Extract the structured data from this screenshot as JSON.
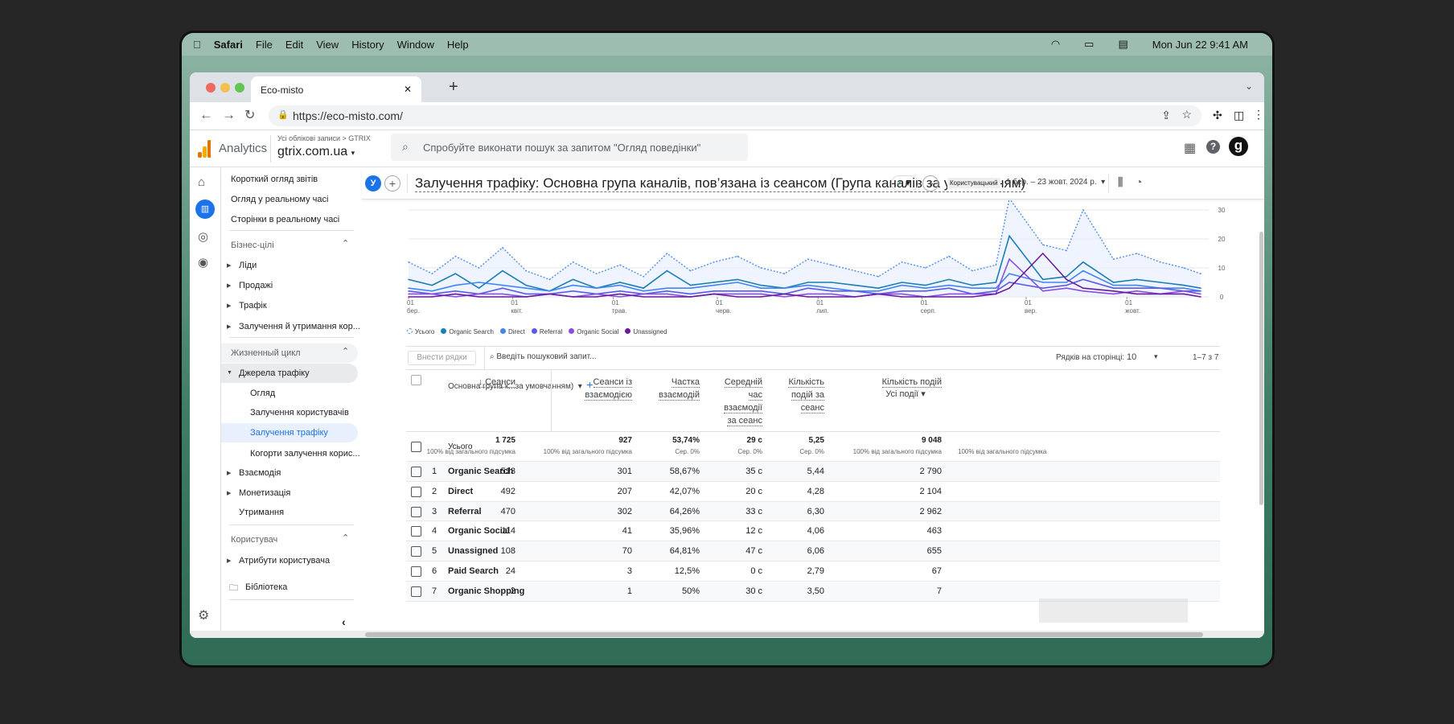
{
  "menubar": {
    "app": "Safari",
    "items": [
      "File",
      "Edit",
      "View",
      "History",
      "Window",
      "Help"
    ],
    "clock": "Mon Jun 22  9:41 AM"
  },
  "browser": {
    "tab_title": "Eco-misto",
    "url": "https://eco-misto.com/"
  },
  "ga": {
    "product": "Analytics",
    "breadcrumb": "Усі облікові записи > GTRIX",
    "property": "gtrix.com.ua",
    "search_placeholder": "Спробуйте виконати пошук за запитом \"Огляд поведінки\"",
    "avatar": "g"
  },
  "nav": {
    "top": [
      "Короткий огляд звітів",
      "Огляд у реальному часі",
      "Сторінки в реальному часі"
    ],
    "business": "Бізнес-цілі",
    "business_items": [
      "Ліди",
      "Продажі",
      "Трафік",
      "Залучення й утримання кор..."
    ],
    "lifecycle": "Жизненный цикл",
    "traffic_sources": "Джерела трафіку",
    "traffic_sub": [
      "Огляд",
      "Залучення користувачів",
      "Залучення трафіку",
      "Когорти залучення корис..."
    ],
    "lifecycle_items": [
      "Взаємодія",
      "Монетизація",
      "Утримання"
    ],
    "user": "Користувач",
    "user_items": [
      "Атрибути користувача"
    ],
    "library": "Бібліотека"
  },
  "report": {
    "segment_badge": "У",
    "title": "Залучення трафіку: Основна група каналів, пов’язана із сеансом (Група каналів за умовчанням)",
    "date_type": "Користувацький",
    "date_range": "1 бер. – 23 жовт. 2024 р."
  },
  "chart_data": {
    "type": "line",
    "ylim": [
      0,
      30
    ],
    "yticks": [
      0,
      10,
      20,
      30
    ],
    "grid": true,
    "legend_position": "bottom-left",
    "xticks": [
      {
        "date": "2024-03-01",
        "l1": "01",
        "l2": "бер."
      },
      {
        "date": "2024-04-01",
        "l1": "01",
        "l2": "квіт."
      },
      {
        "date": "2024-05-01",
        "l1": "01",
        "l2": "трав."
      },
      {
        "date": "2024-06-01",
        "l1": "01",
        "l2": "черв."
      },
      {
        "date": "2024-07-01",
        "l1": "01",
        "l2": "лип."
      },
      {
        "date": "2024-08-01",
        "l1": "01",
        "l2": "серп."
      },
      {
        "date": "2024-09-01",
        "l1": "01",
        "l2": "вер."
      },
      {
        "date": "2024-10-01",
        "l1": "01",
        "l2": "жовт."
      }
    ],
    "x": [
      "2024-03-01",
      "2024-03-08",
      "2024-03-15",
      "2024-03-22",
      "2024-03-29",
      "2024-04-05",
      "2024-04-12",
      "2024-04-19",
      "2024-04-26",
      "2024-05-03",
      "2024-05-10",
      "2024-05-17",
      "2024-05-24",
      "2024-05-31",
      "2024-06-07",
      "2024-06-14",
      "2024-06-21",
      "2024-06-28",
      "2024-07-05",
      "2024-07-12",
      "2024-07-19",
      "2024-07-26",
      "2024-08-02",
      "2024-08-09",
      "2024-08-16",
      "2024-08-23",
      "2024-08-27",
      "2024-09-06",
      "2024-09-13",
      "2024-09-18",
      "2024-09-27",
      "2024-10-04",
      "2024-10-11",
      "2024-10-18",
      "2024-10-23"
    ],
    "series": [
      {
        "name": "Усього",
        "color": "#4d8ef0",
        "style": "dotted",
        "values": [
          12,
          8,
          14,
          10,
          17,
          9,
          6,
          12,
          8,
          11,
          7,
          15,
          9,
          12,
          14,
          10,
          8,
          13,
          11,
          9,
          7,
          12,
          10,
          14,
          9,
          11,
          34,
          18,
          16,
          30,
          13,
          15,
          12,
          10,
          8
        ]
      },
      {
        "name": "Organic Search",
        "color": "#1a7fb5",
        "values": [
          6,
          4,
          8,
          3,
          9,
          4,
          2,
          6,
          3,
          5,
          3,
          9,
          4,
          5,
          6,
          4,
          3,
          5,
          5,
          4,
          3,
          5,
          4,
          6,
          4,
          5,
          21,
          6,
          7,
          12,
          5,
          6,
          5,
          4,
          3
        ]
      },
      {
        "name": "Direct",
        "color": "#4285f4",
        "values": [
          3,
          2,
          4,
          5,
          4,
          3,
          2,
          4,
          3,
          4,
          2,
          3,
          3,
          4,
          5,
          3,
          3,
          4,
          3,
          2,
          2,
          4,
          3,
          4,
          3,
          3,
          8,
          5,
          5,
          9,
          4,
          4,
          3,
          3,
          2
        ]
      },
      {
        "name": "Referral",
        "color": "#5b5bea",
        "values": [
          2,
          1,
          2,
          1,
          3,
          1,
          1,
          2,
          1,
          2,
          1,
          2,
          1,
          2,
          2,
          2,
          1,
          3,
          2,
          2,
          1,
          2,
          2,
          3,
          1,
          2,
          5,
          3,
          4,
          6,
          3,
          3,
          3,
          2,
          2
        ]
      },
      {
        "name": "Organic Social",
        "color": "#8a4fe0",
        "values": [
          1,
          1,
          0,
          1,
          1,
          0,
          1,
          0,
          1,
          0,
          1,
          1,
          0,
          1,
          1,
          1,
          0,
          1,
          1,
          0,
          1,
          1,
          0,
          1,
          1,
          1,
          13,
          2,
          3,
          2,
          1,
          2,
          1,
          2,
          1
        ]
      },
      {
        "name": "Unassigned",
        "color": "#6a1b9a",
        "values": [
          0,
          0,
          1,
          0,
          0,
          0,
          1,
          0,
          0,
          1,
          0,
          0,
          0,
          1,
          0,
          0,
          1,
          0,
          0,
          0,
          1,
          0,
          0,
          0,
          0,
          1,
          3,
          15,
          6,
          3,
          2,
          1,
          1,
          1,
          0
        ]
      }
    ]
  },
  "table": {
    "add_rows": "Внести рядки",
    "search_placeholder": "Введіть пошуковий запит...",
    "rows_per_page_label": "Рядків на сторінці:",
    "rows_per_page": "10",
    "pagination": "1–7 з 7",
    "dimension_header": "Основна група к...за умовчанням)",
    "headers": [
      "↓ Сеанси",
      "Сеанси із взаємодією",
      "Частка взаємодій",
      "Середній час взаємодії за сеанс",
      "Кількість подій за сеанс",
      "Кількість подій"
    ],
    "event_filter": "Усі події",
    "totals": {
      "label": "Усього",
      "values": [
        "1 725",
        "927",
        "53,74%",
        "29 с",
        "5,25",
        "9 048"
      ],
      "subs": [
        "100% від загального підсумка",
        "100% від загального підсумка",
        "Сер. 0%",
        "Сер. 0%",
        "Сер. 0%",
        "100% від загального підсумка",
        "100% від загального підсумка"
      ]
    },
    "rows": [
      {
        "n": "1",
        "channel": "Organic Search",
        "values": [
          "513",
          "301",
          "58,67%",
          "35 с",
          "5,44",
          "2 790"
        ]
      },
      {
        "n": "2",
        "channel": "Direct",
        "values": [
          "492",
          "207",
          "42,07%",
          "20 с",
          "4,28",
          "2 104"
        ]
      },
      {
        "n": "3",
        "channel": "Referral",
        "values": [
          "470",
          "302",
          "64,26%",
          "33 с",
          "6,30",
          "2 962"
        ]
      },
      {
        "n": "4",
        "channel": "Organic Social",
        "values": [
          "114",
          "41",
          "35,96%",
          "12 с",
          "4,06",
          "463"
        ]
      },
      {
        "n": "5",
        "channel": "Unassigned",
        "values": [
          "108",
          "70",
          "64,81%",
          "47 с",
          "6,06",
          "655"
        ]
      },
      {
        "n": "6",
        "channel": "Paid Search",
        "values": [
          "24",
          "3",
          "12,5%",
          "0 с",
          "2,79",
          "67"
        ]
      },
      {
        "n": "7",
        "channel": "Organic Shopping",
        "values": [
          "2",
          "1",
          "50%",
          "30 с",
          "3,50",
          "7"
        ]
      }
    ]
  }
}
